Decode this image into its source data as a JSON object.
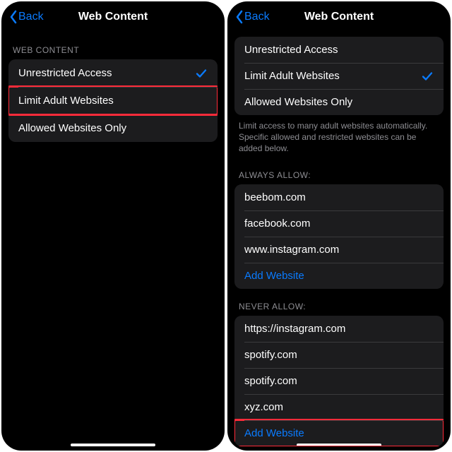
{
  "left": {
    "nav": {
      "back": "Back",
      "title": "Web Content"
    },
    "sectionHeader": "WEB CONTENT",
    "options": {
      "unrestricted": "Unrestricted Access",
      "limit": "Limit Adult Websites",
      "allowedOnly": "Allowed Websites Only"
    }
  },
  "right": {
    "nav": {
      "back": "Back",
      "title": "Web Content"
    },
    "options": {
      "unrestricted": "Unrestricted Access",
      "limit": "Limit Adult Websites",
      "allowedOnly": "Allowed Websites Only"
    },
    "footer": "Limit access to many adult websites automatically. Specific allowed and restricted websites can be added below.",
    "alwaysAllowHeader": "ALWAYS ALLOW:",
    "alwaysAllow": [
      "beebom.com",
      "facebook.com",
      "www.instagram.com"
    ],
    "addWebsite": "Add Website",
    "neverAllowHeader": "NEVER ALLOW:",
    "neverAllow": [
      "https://instagram.com",
      "spotify.com",
      "spotify.com",
      "xyz.com"
    ]
  }
}
